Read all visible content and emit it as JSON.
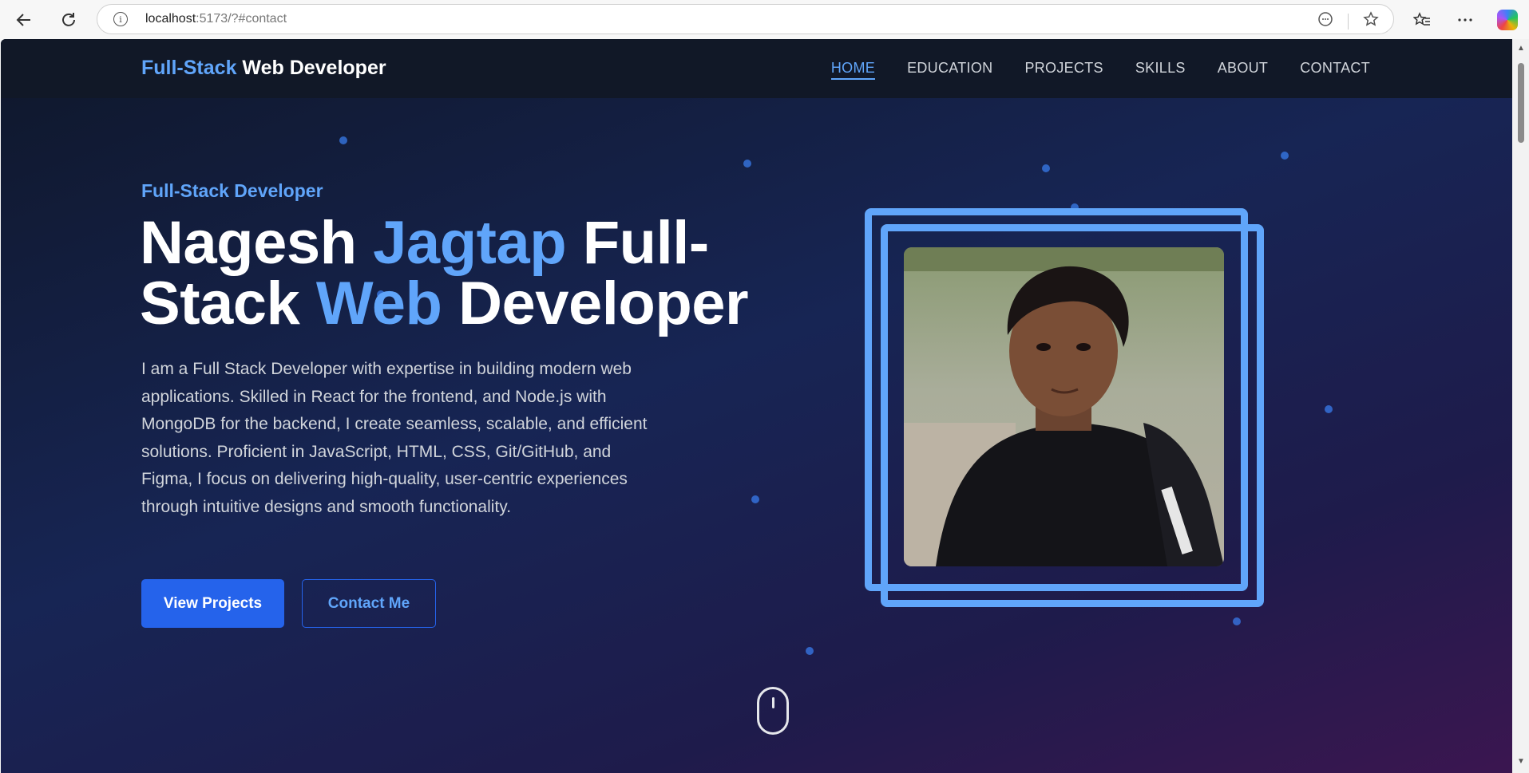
{
  "browser": {
    "url_host": "localhost",
    "url_rest": ":5173/?#contact"
  },
  "site": {
    "brand_accent": "Full-Stack",
    "brand_rest": " Web Developer",
    "menu": [
      "HOME",
      "EDUCATION",
      "PROJECTS",
      "SKILLS",
      "ABOUT",
      "CONTACT"
    ],
    "active_menu": "HOME"
  },
  "hero": {
    "eyebrow": "Full-Stack Developer",
    "headline_1": "Nagesh ",
    "headline_2": "Jagtap",
    "headline_3": " Full-",
    "headline_4": "Stack ",
    "headline_5": "Web",
    "headline_6": " Developer",
    "description": "I am a Full Stack Developer with expertise in building modern web applications. Skilled in React for the frontend, and Node.js with MongoDB for the backend, I create seamless, scalable, and efficient solutions. Proficient in JavaScript, HTML, CSS, Git/GitHub, and Figma, I focus on delivering high-quality, user-centric experiences through intuitive designs and smooth functionality.",
    "btn_primary": "View Projects",
    "btn_secondary": "Contact Me"
  },
  "colors": {
    "accent": "#60a5fa",
    "primary_button": "#2563eb",
    "nav_bg": "#111827"
  }
}
